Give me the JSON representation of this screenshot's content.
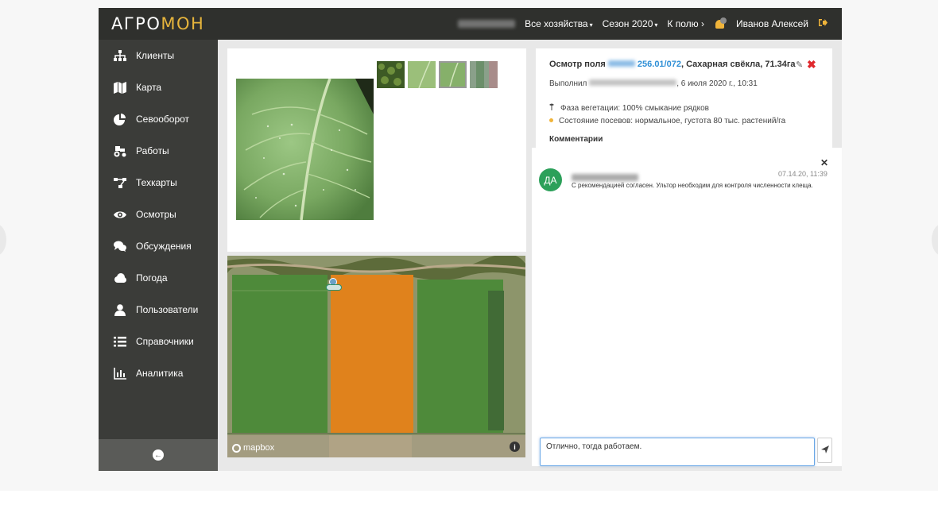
{
  "brand": {
    "part1": "АГРО",
    "part2": "МОН"
  },
  "topnav": {
    "farms": "Все хозяйства",
    "season": "Сезон 2020",
    "to_field": "К полю ›",
    "user": "Иванов Алексей"
  },
  "sidebar": {
    "items": [
      {
        "label": "Клиенты",
        "icon": "sitemap-icon"
      },
      {
        "label": "Карта",
        "icon": "map-icon"
      },
      {
        "label": "Севооборот",
        "icon": "pie-chart-icon"
      },
      {
        "label": "Работы",
        "icon": "tractor-icon"
      },
      {
        "label": "Техкарты",
        "icon": "flowchart-icon"
      },
      {
        "label": "Осмотры",
        "icon": "eye-icon"
      },
      {
        "label": "Обсуждения",
        "icon": "comments-icon"
      },
      {
        "label": "Погода",
        "icon": "cloud-icon"
      },
      {
        "label": "Пользователи",
        "icon": "user-icon"
      },
      {
        "label": "Справочники",
        "icon": "list-icon"
      },
      {
        "label": "Аналитика",
        "icon": "bar-chart-icon"
      }
    ]
  },
  "inspection": {
    "title_prefix": "Осмотр поля",
    "field_code": "256.01/072",
    "title_suffix": ", Сахарная свёкла, 71.34га",
    "performed_by_label": "Выполнил",
    "performed_date": ", 6 июля 2020 г., 10:31",
    "phase": "Фаза вегетации: 100% смыкание рядков",
    "state": "Состояние посевов: нормальное, густота 80 тыс. растений/га",
    "comments_heading": "Комментарии"
  },
  "comment": {
    "avatar_initials": "ДА",
    "time": "07.14.20, 11:39",
    "text": "С рекомендацией согласен. Ультор необходим для контроля численности клеща."
  },
  "reply": {
    "value": "Отлично, тогда работаем."
  },
  "map": {
    "attribution": "mapbox"
  },
  "colors": {
    "accent": "#e6b43c",
    "link": "#2f8fd6",
    "danger": "#e0282d",
    "avatar": "#2ca05a",
    "field": "#e0821c"
  }
}
